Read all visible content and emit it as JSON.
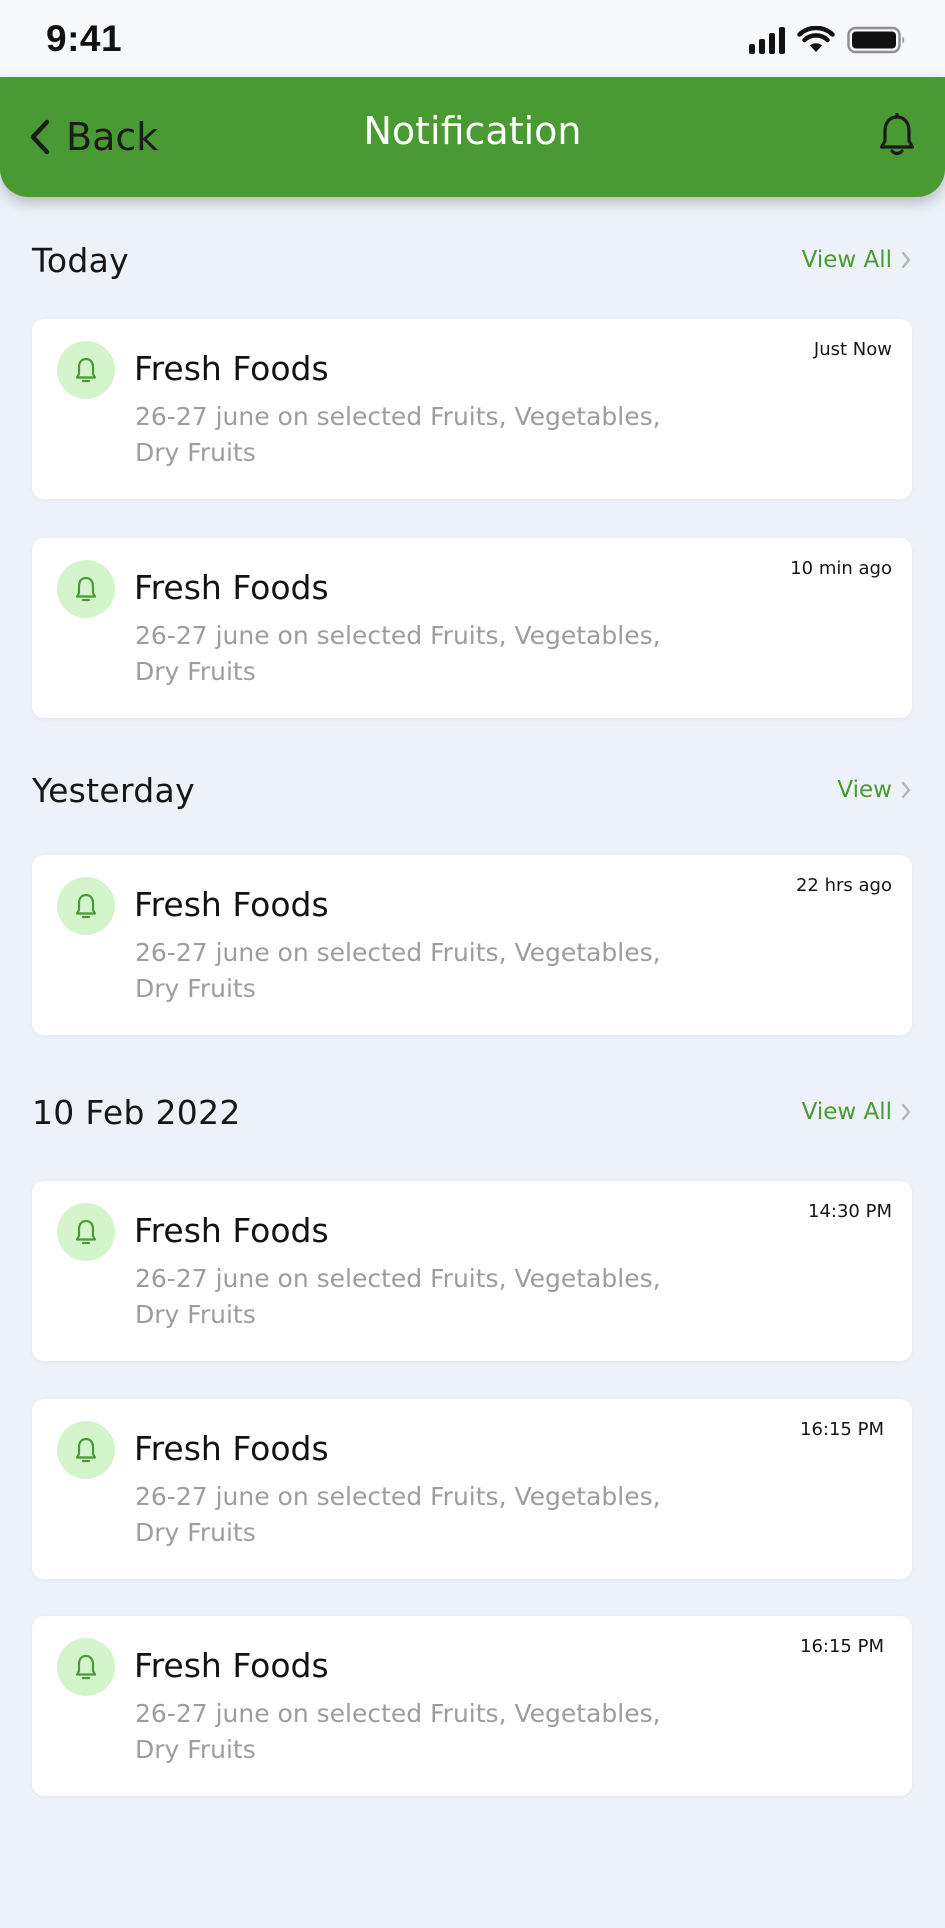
{
  "status_bar": {
    "time": "9:41"
  },
  "header": {
    "back_label": "Back",
    "title": "Notification"
  },
  "sections": [
    {
      "title": "Today",
      "link": "View All",
      "notifications": [
        {
          "title": "Fresh Foods",
          "desc_line1": "26-27 june on selected Fruits, Vegetables,",
          "desc_line2": "Dry Fruits",
          "time": "Just Now"
        },
        {
          "title": "Fresh Foods",
          "desc_line1": "26-27 june on selected Fruits, Vegetables,",
          "desc_line2": "Dry Fruits",
          "time": "10 min ago"
        }
      ]
    },
    {
      "title": "Yesterday",
      "link": "View",
      "notifications": [
        {
          "title": "Fresh Foods",
          "desc_line1": "26-27 june on selected Fruits, Vegetables,",
          "desc_line2": "Dry Fruits",
          "time": "22 hrs ago"
        }
      ]
    },
    {
      "title": "10 Feb 2022",
      "link": "View All",
      "notifications": [
        {
          "title": "Fresh Foods",
          "desc_line1": "26-27 june on selected Fruits, Vegetables,",
          "desc_line2": "Dry Fruits",
          "time": "14:30 PM"
        },
        {
          "title": "Fresh Foods",
          "desc_line1": "26-27 june on selected Fruits, Vegetables,",
          "desc_line2": "Dry Fruits",
          "time": "16:15 PM"
        },
        {
          "title": "Fresh Foods",
          "desc_line1": "26-27 june on selected Fruits, Vegetables,",
          "desc_line2": "Dry Fruits",
          "time": "16:15 PM"
        }
      ]
    }
  ],
  "icons": {
    "back": "chevron-left-icon",
    "header_bell": "bell-icon",
    "card_bell": "bell-icon",
    "section_link": "chevron-right-icon"
  },
  "colors": {
    "brand_green": "#4a9a33",
    "icon_bg": "#d4f5cc",
    "background": "#edf1f9",
    "card": "#ffffff",
    "muted_text": "#9d9d9d"
  }
}
